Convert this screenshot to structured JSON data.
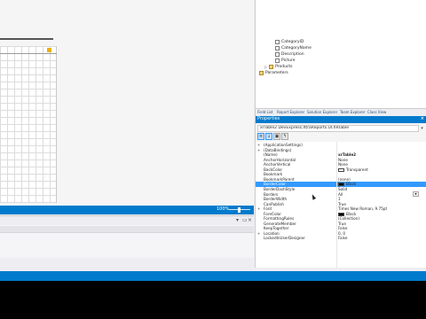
{
  "designer": {
    "zoom": "100%"
  },
  "field_list": {
    "items": [
      {
        "label": "CategoryID",
        "type": "field"
      },
      {
        "label": "CategoryName",
        "type": "field"
      },
      {
        "label": "Description",
        "type": "field"
      },
      {
        "label": "Picture",
        "type": "field"
      },
      {
        "label": "Products",
        "type": "folder"
      },
      {
        "label": "Parameters",
        "type": "folder"
      }
    ]
  },
  "explorer_tabs": [
    "Field List",
    "Report Explorer",
    "Solution Explorer",
    "Team Explorer",
    "Class View"
  ],
  "properties": {
    "title": "Properties",
    "selector": "xrTable2  DevExpress.XtraReports.UI.XRTable",
    "rows": [
      {
        "name": "(ApplicationSettings)",
        "value": "",
        "expander": "+"
      },
      {
        "name": "(DataBindings)",
        "value": "",
        "expander": "+"
      },
      {
        "name": "(Name)",
        "value": "xrTable2",
        "bold": true
      },
      {
        "name": "AnchorHorizontal",
        "value": "None"
      },
      {
        "name": "AnchorVertical",
        "value": "None"
      },
      {
        "name": "BackColor",
        "value": "Transparent",
        "swatch": "#ffffff"
      },
      {
        "name": "Bookmark",
        "value": ""
      },
      {
        "name": "BookmarkParent",
        "value": "(none)"
      },
      {
        "name": "BorderColor",
        "value": "Black",
        "swatch": "#000000",
        "selected": true
      },
      {
        "name": "BorderDashStyle",
        "value": "Solid"
      },
      {
        "name": "Borders",
        "value": "All"
      },
      {
        "name": "BorderWidth",
        "value": "1"
      },
      {
        "name": "CanPublish",
        "value": "True"
      },
      {
        "name": "Font",
        "value": "Times New Roman, 9.75pt",
        "expander": "+"
      },
      {
        "name": "ForeColor",
        "value": "Black",
        "swatch": "#000000"
      },
      {
        "name": "FormattingRules",
        "value": "(Collection)"
      },
      {
        "name": "GenerateMember",
        "value": "True"
      },
      {
        "name": "KeepTogether",
        "value": "False"
      },
      {
        "name": "Location",
        "value": "0, 0",
        "expander": "+"
      },
      {
        "name": "LockedInUserDesigner",
        "value": "False"
      }
    ]
  },
  "colors": {
    "accent": "#007acc",
    "selection": "#3399ff"
  }
}
